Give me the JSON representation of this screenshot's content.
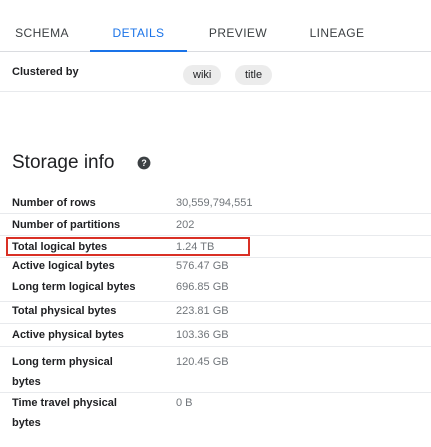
{
  "tabs": [
    {
      "label": "SCHEMA",
      "active": false
    },
    {
      "label": "DETAILS",
      "active": true
    },
    {
      "label": "PREVIEW",
      "active": false
    },
    {
      "label": "LINEAGE",
      "active": false
    }
  ],
  "clustered": {
    "label": "Clustered by",
    "chips": [
      "wiki",
      "title"
    ]
  },
  "storage": {
    "title": "Storage info",
    "help_icon": "help-circle-icon",
    "rows": [
      {
        "key": "Number of rows",
        "value": "30,559,794,551"
      },
      {
        "key": "Number of partitions",
        "value": "202"
      },
      {
        "key": "Total logical bytes",
        "value": "1.24 TB"
      },
      {
        "key": "Active logical bytes",
        "value": "576.47 GB",
        "highlighted": true
      },
      {
        "key": "Long term logical bytes",
        "value": "696.85 GB"
      },
      {
        "key": "Total physical bytes",
        "value": "223.81 GB"
      },
      {
        "key": "Active physical bytes",
        "value": "103.36 GB"
      },
      {
        "key": "Long term physical bytes",
        "value": "120.45 GB"
      },
      {
        "key": "Time travel physical bytes",
        "value": "0 B"
      }
    ]
  },
  "colors": {
    "accent": "#1a73e8",
    "highlight_border": "#d93025"
  }
}
